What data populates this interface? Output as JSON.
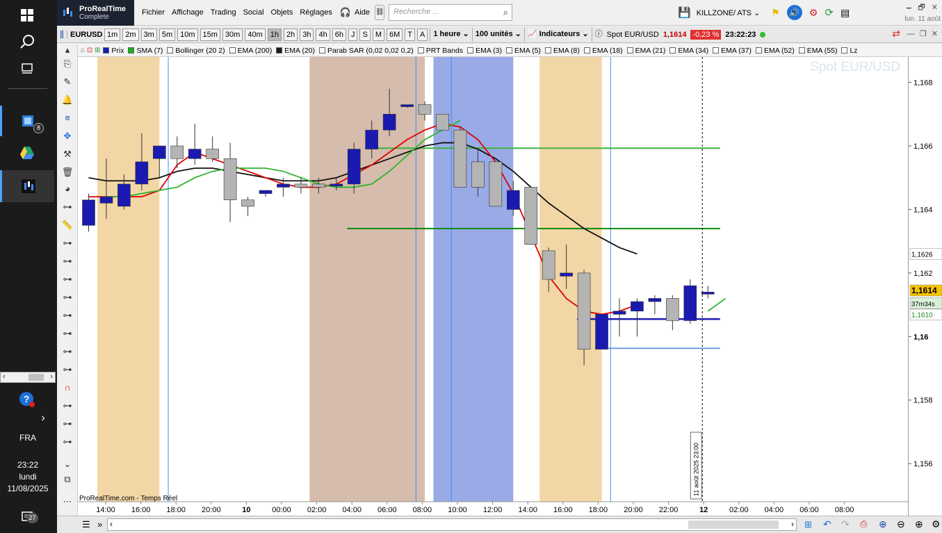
{
  "taskbar": {
    "badge_app": "8",
    "lang": "FRA",
    "time": "23:22",
    "day": "lundi",
    "date": "11/08/2025",
    "notif_count": "27"
  },
  "app": {
    "name": "ProRealTime",
    "edition": "Complete",
    "menu": [
      "Fichier",
      "Affichage",
      "Trading",
      "Social",
      "Objets",
      "Réglages",
      "Aide"
    ],
    "search_placeholder": "Recherche ...",
    "workspace": "KILLZONE/ ATS",
    "clock_date": "lun. 11 août"
  },
  "toolbar": {
    "symbol": "EURUSD",
    "timeframes": [
      "1m",
      "2m",
      "3m",
      "5m",
      "10m",
      "15m",
      "30m",
      "40m",
      "1h",
      "2h",
      "3h",
      "4h",
      "6h",
      "J",
      "S",
      "M",
      "6M",
      "T",
      "A"
    ],
    "selected_tf": "1h",
    "period": "1 heure",
    "units": "100 unités",
    "indicators": "Indicateurs",
    "instrument": "Spot EUR/USD",
    "last_price": "1,1614",
    "change": "-0,23 %",
    "clock": "23:22:23"
  },
  "indicators_bar": [
    {
      "label": "Prix",
      "color": "#1a1ab0"
    },
    {
      "label": "SMA (7)",
      "color": "#1ab01a"
    },
    {
      "label": "Bollinger (20 2)",
      "color": ""
    },
    {
      "label": "EMA (200)",
      "color": ""
    },
    {
      "label": "EMA (20)",
      "color": "#1a1a1a"
    },
    {
      "label": "Parab SAR (0,02 0,02 0,2)",
      "color": ""
    },
    {
      "label": "PRT Bands",
      "color": ""
    },
    {
      "label": "EMA (3)",
      "color": ""
    },
    {
      "label": "EMA (5)",
      "color": ""
    },
    {
      "label": "EMA (8)",
      "color": ""
    },
    {
      "label": "EMA (18)",
      "color": ""
    },
    {
      "label": "EMA (21)",
      "color": ""
    },
    {
      "label": "EMA (34)",
      "color": ""
    },
    {
      "label": "EMA (37)",
      "color": ""
    },
    {
      "label": "EMA (52)",
      "color": ""
    },
    {
      "label": "EMA (55)",
      "color": ""
    },
    {
      "label": "Lz",
      "color": ""
    }
  ],
  "chart": {
    "watermark": "Spot EUR/USD",
    "source": "ProRealTime.com - Temps Réel",
    "cursor_label": "11 août 2025 23:00",
    "timer": "37m34s",
    "price_label_current": "1,1614",
    "price_label_green": "1,1610",
    "price_label_line": "1,1626",
    "colors": {
      "up": "#1a1ab0",
      "down": "#b4b4b4",
      "ema_red": "#e00000",
      "ema_black": "#111111",
      "sma_green": "#2db52d"
    }
  },
  "chart_data": {
    "type": "candlestick",
    "yticks": [
      "1,168",
      "1,166",
      "1,164",
      "1,162",
      "1,16",
      "1,158",
      "1,156"
    ],
    "xticks": [
      "14:00",
      "16:00",
      "18:00",
      "20:00",
      "10",
      "00:00",
      "02:00",
      "04:00",
      "06:00",
      "08:00",
      "10:00",
      "12:00",
      "14:00",
      "16:00",
      "18:00",
      "20:00",
      "22:00",
      "12",
      "02:00",
      "04:00",
      "06:00",
      "08:00"
    ],
    "xtick_bold": [
      "10",
      "12"
    ],
    "ylim": [
      1.1548,
      1.1688
    ],
    "candles": [
      {
        "o": 1.1635,
        "h": 1.1645,
        "l": 1.1633,
        "c": 1.1643
      },
      {
        "o": 1.1642,
        "h": 1.1656,
        "l": 1.1637,
        "c": 1.1644
      },
      {
        "o": 1.1641,
        "h": 1.1651,
        "l": 1.164,
        "c": 1.1648
      },
      {
        "o": 1.1648,
        "h": 1.1664,
        "l": 1.1646,
        "c": 1.1655
      },
      {
        "o": 1.1656,
        "h": 1.166,
        "l": 1.165,
        "c": 1.166
      },
      {
        "o": 1.166,
        "h": 1.1663,
        "l": 1.1653,
        "c": 1.1656
      },
      {
        "o": 1.1656,
        "h": 1.1667,
        "l": 1.1654,
        "c": 1.1659
      },
      {
        "o": 1.1659,
        "h": 1.1663,
        "l": 1.1655,
        "c": 1.1656
      },
      {
        "o": 1.1656,
        "h": 1.1661,
        "l": 1.1636,
        "c": 1.1643
      },
      {
        "o": 1.1643,
        "h": 1.1644,
        "l": 1.1638,
        "c": 1.1641
      },
      {
        "o": 1.1645,
        "h": 1.1646,
        "l": 1.1644,
        "c": 1.1646
      },
      {
        "o": 1.1647,
        "h": 1.165,
        "l": 1.1644,
        "c": 1.1648
      },
      {
        "o": 1.1648,
        "h": 1.165,
        "l": 1.1645,
        "c": 1.1647
      },
      {
        "o": 1.1648,
        "h": 1.165,
        "l": 1.1645,
        "c": 1.1647
      },
      {
        "o": 1.1648,
        "h": 1.165,
        "l": 1.1646,
        "c": 1.1648
      },
      {
        "o": 1.1648,
        "h": 1.1661,
        "l": 1.1645,
        "c": 1.1659
      },
      {
        "o": 1.1659,
        "h": 1.1668,
        "l": 1.1656,
        "c": 1.1665
      },
      {
        "o": 1.1665,
        "h": 1.1678,
        "l": 1.1663,
        "c": 1.167
      },
      {
        "o": 1.1673,
        "h": 1.1673,
        "l": 1.1672,
        "c": 1.1673
      },
      {
        "o": 1.1673,
        "h": 1.1674,
        "l": 1.1668,
        "c": 1.167
      },
      {
        "o": 1.167,
        "h": 1.167,
        "l": 1.1665,
        "c": 1.1665
      },
      {
        "o": 1.1665,
        "h": 1.1666,
        "l": 1.1647,
        "c": 1.1647
      },
      {
        "o": 1.1655,
        "h": 1.1659,
        "l": 1.1644,
        "c": 1.1647
      },
      {
        "o": 1.1655,
        "h": 1.1655,
        "l": 1.1641,
        "c": 1.1641
      },
      {
        "o": 1.164,
        "h": 1.1649,
        "l": 1.1638,
        "c": 1.1646
      },
      {
        "o": 1.1647,
        "h": 1.1647,
        "l": 1.163,
        "c": 1.1629
      },
      {
        "o": 1.1627,
        "h": 1.1628,
        "l": 1.1614,
        "c": 1.1618
      },
      {
        "o": 1.1619,
        "h": 1.1629,
        "l": 1.1615,
        "c": 1.162
      },
      {
        "o": 1.162,
        "h": 1.1621,
        "l": 1.1591,
        "c": 1.1596
      },
      {
        "o": 1.1596,
        "h": 1.1606,
        "l": 1.1596,
        "c": 1.1607
      },
      {
        "o": 1.1607,
        "h": 1.1612,
        "l": 1.16,
        "c": 1.1608
      },
      {
        "o": 1.1608,
        "h": 1.1612,
        "l": 1.16,
        "c": 1.1611
      },
      {
        "o": 1.1611,
        "h": 1.1613,
        "l": 1.1607,
        "c": 1.1612
      },
      {
        "o": 1.1612,
        "h": 1.1613,
        "l": 1.1602,
        "c": 1.1605
      },
      {
        "o": 1.1605,
        "h": 1.1618,
        "l": 1.1604,
        "c": 1.1616
      },
      {
        "o": 1.1614,
        "h": 1.1616,
        "l": 1.1612,
        "c": 1.1614
      }
    ],
    "ema_red": [
      1.1644,
      1.1644,
      1.1644,
      1.1644,
      1.1646,
      1.1654,
      1.1658,
      1.1656,
      1.1654,
      1.1652,
      1.165,
      1.1648,
      1.1647,
      1.1647,
      1.1648,
      1.1651,
      1.1654,
      1.1658,
      1.1662,
      1.1665,
      1.1667,
      1.1666,
      1.1662,
      1.1655,
      1.1645,
      1.1632,
      1.1619,
      1.1612,
      1.1608,
      1.1607,
      1.1608,
      1.161
    ],
    "ema_black": [
      1.165,
      1.1649,
      1.1649,
      1.1649,
      1.165,
      1.1652,
      1.1653,
      1.1653,
      1.1652,
      1.1651,
      1.165,
      1.1649,
      1.1649,
      1.1649,
      1.165,
      1.1652,
      1.1654,
      1.1656,
      1.1658,
      1.166,
      1.1661,
      1.1661,
      1.1659,
      1.1656,
      1.1652,
      1.1647,
      1.1642,
      1.1638,
      1.1634,
      1.1631,
      1.1628,
      1.1626
    ],
    "sma_green_start": 1,
    "sma_green": [
      1.1644,
      1.1644,
      1.1645,
      1.1646,
      1.1647,
      1.165,
      1.1652,
      1.1653,
      1.1653,
      1.1653,
      1.1652,
      1.165,
      1.1648,
      1.1647,
      1.1647,
      1.1648,
      1.1652,
      1.1657,
      1.1662,
      1.1665,
      1.1668
    ],
    "sma_green_tail": [
      1.1608,
      1.1612
    ],
    "hlines": [
      {
        "y": 1.16593,
        "color": "#3cb43c",
        "from": 16,
        "to": 36
      },
      {
        "y": 1.1634,
        "color": "#0a8a0a",
        "from": 15,
        "to": 36
      },
      {
        "y": 1.16055,
        "color": "#1a1ab0",
        "from": 28,
        "to": 36
      },
      {
        "y": 1.15963,
        "color": "#6fa0e8",
        "from": 29,
        "to": 36
      }
    ],
    "zones": [
      {
        "from": 1,
        "to": 4,
        "color": "#f2d6a6"
      },
      {
        "from": 13,
        "to": 19,
        "color": "#d6bcac"
      },
      {
        "from": 20,
        "to": 24,
        "color": "#9aaae6"
      },
      {
        "from": 26,
        "to": 29,
        "color": "#f2d6a6"
      }
    ]
  }
}
